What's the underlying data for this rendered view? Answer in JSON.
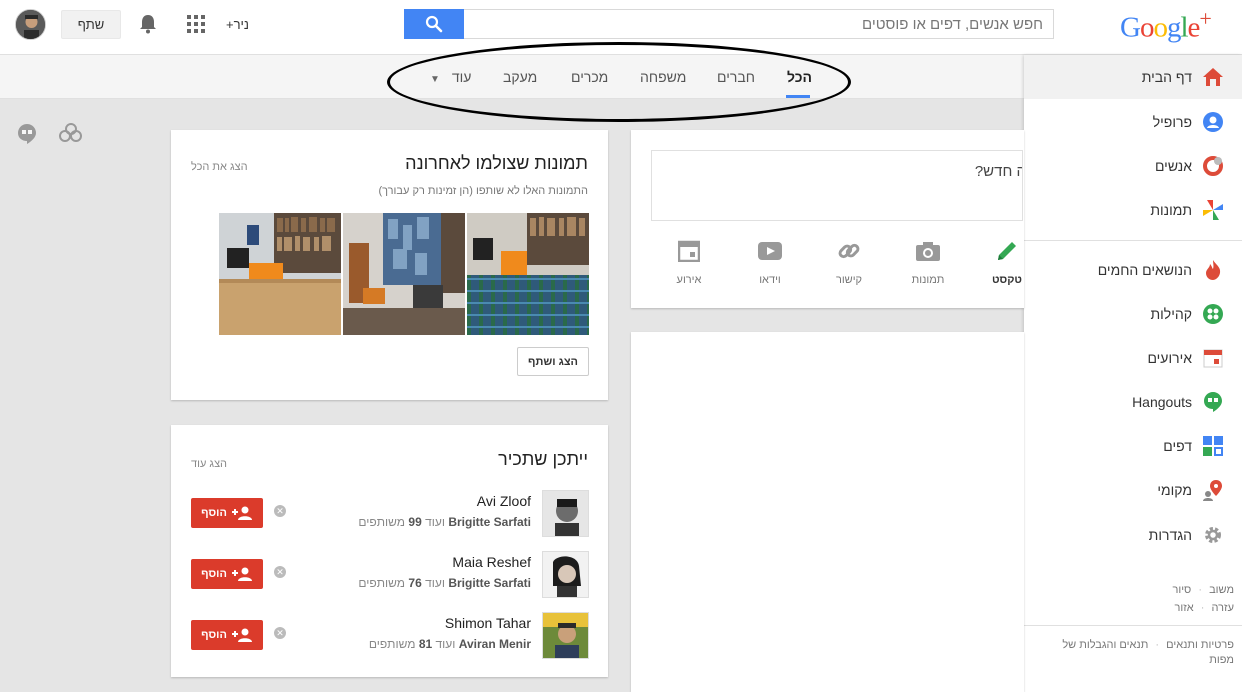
{
  "topbar": {
    "logo": {
      "g1": "G",
      "g2": "o",
      "g3": "o",
      "g4": "g",
      "g5": "l",
      "g6": "e",
      "plus": "+"
    },
    "search_placeholder": "חפש אנשים, דפים או פוסטים",
    "user_name": "+ניר",
    "share_label": "שתף"
  },
  "filters": {
    "tabs": [
      "הכל",
      "חברים",
      "משפחה",
      "מכרים",
      "מעקב",
      "עוד"
    ]
  },
  "sidebar": {
    "items": [
      "דף הבית",
      "פרופיל",
      "אנשים",
      "תמונות",
      "הנושאים החמים",
      "קהילות",
      "אירועים",
      "Hangouts",
      "דפים",
      "מקומי",
      "הגדרות"
    ],
    "footer": {
      "feedback": "משוב",
      "tour": "סיור",
      "help": "עזרה",
      "area": "אזור",
      "privacy": "פרטיות ותנאים",
      "terms": "תנאים והגבלות של",
      "maps": "מפות"
    }
  },
  "photos_card": {
    "title": "תמונות שצולמו לאחרונה",
    "view_all": "הצג את הכל",
    "subtitle": "התמונות האלו לא שותפו (הן זמינות רק עבורך)",
    "show_share": "הצג ושתף"
  },
  "people_card": {
    "title": "ייתכן שתכיר",
    "view_more": "הצג עוד",
    "add_label": "הוסף",
    "people": [
      {
        "name": "Avi Zloof",
        "via": "Brigitte Sarfati",
        "and": "ועוד",
        "count": "99",
        "suffix": "משותפים"
      },
      {
        "name": "Maia Reshef",
        "via": "Brigitte Sarfati",
        "and": "ועוד",
        "count": "76",
        "suffix": "משותפים"
      },
      {
        "name": "Shimon Tahar",
        "via": "Aviran Menir",
        "and": "ועוד",
        "count": "81",
        "suffix": "משותפים"
      }
    ]
  },
  "post_card": {
    "prompt": "ה חדש?",
    "actions": [
      "טקסט",
      "תמונות",
      "קישור",
      "וידאו",
      "אירוע"
    ]
  },
  "colors": {
    "accent": "#4285f4",
    "add_button": "#db3b2b"
  }
}
